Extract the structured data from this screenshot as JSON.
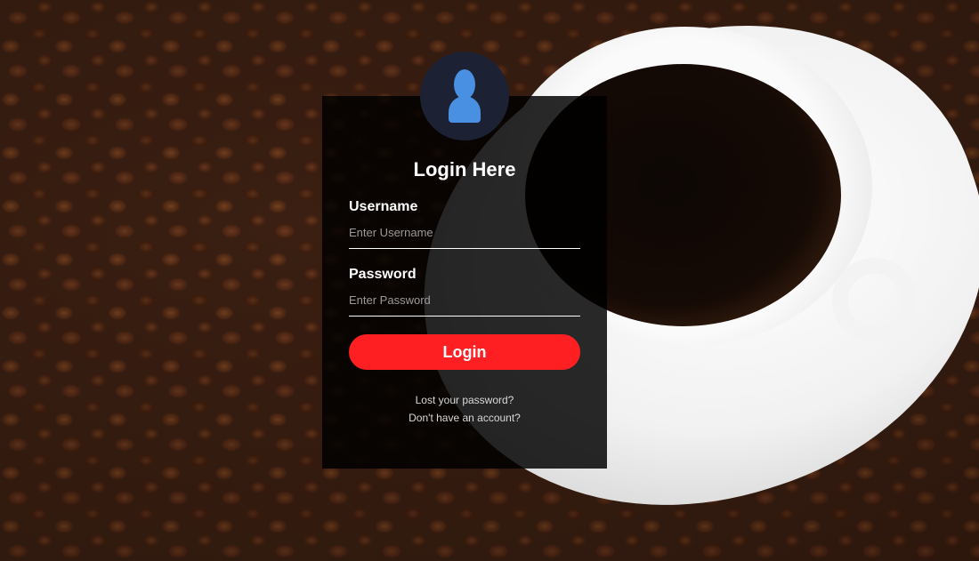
{
  "login": {
    "title": "Login Here",
    "username": {
      "label": "Username",
      "placeholder": "Enter Username",
      "value": ""
    },
    "password": {
      "label": "Password",
      "placeholder": "Enter Password",
      "value": ""
    },
    "submit_label": "Login",
    "links": {
      "lost_password": "Lost your password?",
      "signup": "Don't have an account?"
    },
    "avatar_icon": "user-icon"
  },
  "colors": {
    "accent": "#fe1f22",
    "panel": "#000000",
    "avatar_bg": "#1c2233",
    "avatar_icon": "#4a90e2"
  },
  "background": {
    "subject": "coffee beans with cup of black coffee"
  }
}
